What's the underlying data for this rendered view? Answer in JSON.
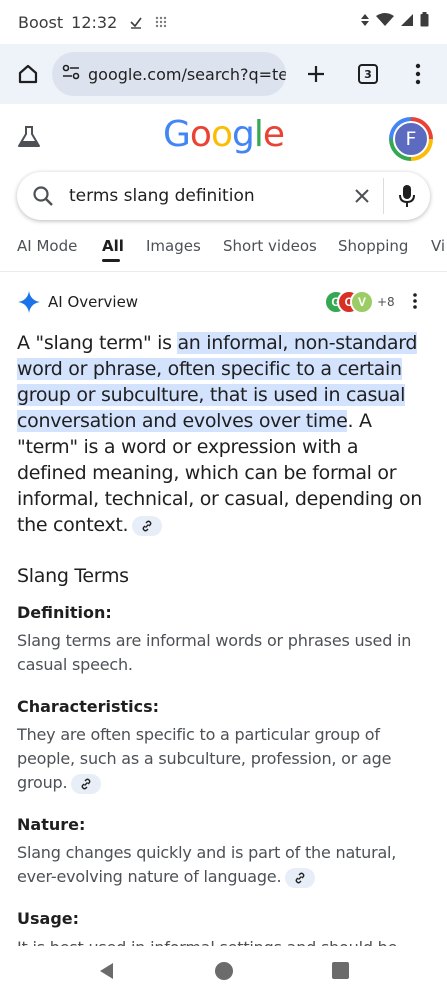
{
  "status_bar": {
    "carrier": "Boost",
    "time": "12:32"
  },
  "browser": {
    "url": "google.com/search?q=te",
    "tab_count": "3"
  },
  "google": {
    "logo_letters": [
      {
        "ch": "G",
        "color": "#4285f4"
      },
      {
        "ch": "o",
        "color": "#ea4335"
      },
      {
        "ch": "o",
        "color": "#fbbc05"
      },
      {
        "ch": "g",
        "color": "#4285f4"
      },
      {
        "ch": "l",
        "color": "#34a853"
      },
      {
        "ch": "e",
        "color": "#ea4335"
      }
    ],
    "avatar_letter": "F"
  },
  "search": {
    "query": "terms slang definition"
  },
  "tabs": [
    {
      "label": "AI Mode",
      "active": false
    },
    {
      "label": "All",
      "active": true
    },
    {
      "label": "Images",
      "active": false
    },
    {
      "label": "Short videos",
      "active": false
    },
    {
      "label": "Shopping",
      "active": false
    },
    {
      "label": "Vi",
      "active": false
    }
  ],
  "ai_overview": {
    "title": "AI Overview",
    "source_more": "+8",
    "source_avatars": [
      {
        "letter": "G",
        "color": "#34a853"
      },
      {
        "letter": "C",
        "color": "#d93025"
      },
      {
        "letter": "V",
        "color": "#9ccc65"
      }
    ],
    "para_1": "A \"slang term\" is ",
    "para_highlight": "an informal, non-standard word or phrase, often specific to a certain group or subculture, that is used in casual conversation and evolves over time",
    "para_2": ". A \"term\" is a word or expression with a defined meaning, which can be formal or informal, technical, or casual, depending on the context."
  },
  "section": {
    "heading": "Slang Terms",
    "items": [
      {
        "label": "Definition:",
        "text": "Slang terms are informal words or phrases used in casual speech."
      },
      {
        "label": "Characteristics:",
        "text": "They are often specific to a particular group of people, such as a subculture, profession, or age group."
      },
      {
        "label": "Nature:",
        "text": "Slang changes quickly and is part of the natural, ever-evolving nature of language."
      },
      {
        "label": "Usage:",
        "text": "It is best used in informal settings and should be"
      }
    ]
  },
  "colors": {
    "highlight": "#d3e3fd",
    "accent_blue": "#1a73e8"
  }
}
